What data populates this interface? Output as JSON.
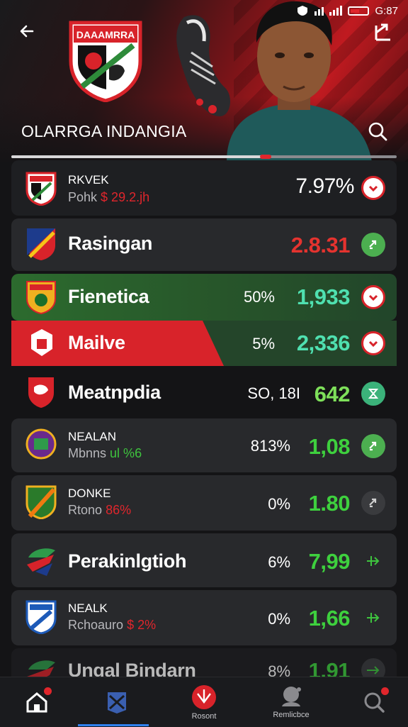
{
  "status_bar": {
    "time": "G:87"
  },
  "header": {
    "crest_text": "DAAAMRRA",
    "title": "OLARRGA INDANGIA",
    "progress": 0.66
  },
  "rows": [
    {
      "name": "RKVEK",
      "sub_prefix": "Pohk",
      "sub_value": "$ 29.2.jh",
      "percent": "",
      "odds": "7.97%",
      "action": "chevron-down"
    },
    {
      "name": "Rasingan",
      "sub_prefix": "",
      "sub_value": "",
      "percent": "",
      "odds": "2.8.31",
      "action": "swap"
    },
    {
      "name": "Fienetica",
      "sub_prefix": "",
      "sub_value": "",
      "percent": "50%",
      "odds": "1,933",
      "action": "chevron-down"
    },
    {
      "name": "Mailve",
      "sub_prefix": "",
      "sub_value": "",
      "percent": "5%",
      "odds": "2,336",
      "action": "chevron-down"
    },
    {
      "name": "Meatnpdia",
      "sub_prefix": "",
      "sub_value": "",
      "percent": "SO, 18I",
      "odds": "642",
      "action": "hourglass"
    },
    {
      "name": "NEALAN",
      "sub_prefix": "Mbnns",
      "sub_value": "ul %6",
      "percent": "813%",
      "odds": "1,08",
      "action": "swap"
    },
    {
      "name": "DONKE",
      "sub_prefix": "Rtono",
      "sub_value": "86%",
      "percent": "0%",
      "odds": "1.80",
      "action": "swap"
    },
    {
      "name": "Perakinlgtioh",
      "sub_prefix": "",
      "sub_value": "",
      "percent": "6%",
      "odds": "7,99",
      "action": "arrows"
    },
    {
      "name": "NEALK",
      "sub_prefix": "Rchoauro",
      "sub_value": "$ 2%",
      "percent": "0%",
      "odds": "1,66",
      "action": "arrows"
    },
    {
      "name": "Ungal Bindarn",
      "sub_prefix": "",
      "sub_value": "",
      "percent": "8%",
      "odds": "1.91",
      "action": "arrows"
    }
  ],
  "nav": [
    {
      "label": "",
      "icon": "home-icon"
    },
    {
      "label": "",
      "icon": "matches-icon"
    },
    {
      "label": "Rosont",
      "icon": "ball-icon"
    },
    {
      "label": "Remlicbce",
      "icon": "profile-icon"
    },
    {
      "label": "",
      "icon": "search-icon"
    }
  ],
  "colors": {
    "accent_red": "#d8232a",
    "accent_green": "#3ed03e",
    "nav_blue": "#2f80ed"
  }
}
